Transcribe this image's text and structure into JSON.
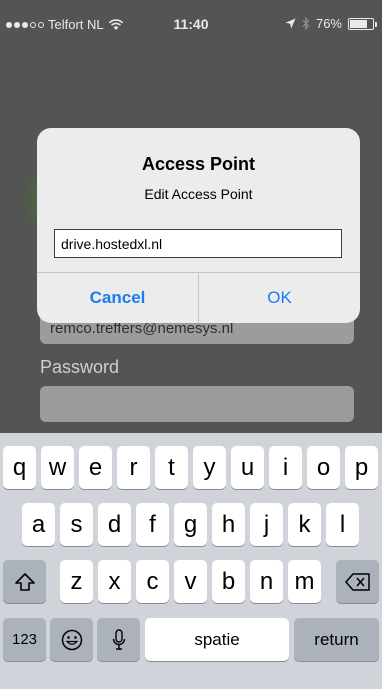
{
  "status_bar": {
    "carrier": "Telfort NL",
    "time": "11:40",
    "battery_percent": "76%",
    "battery_level": 0.76
  },
  "background_form": {
    "email_value": "remco.treffers@nemesys.nl",
    "password_label": "Password"
  },
  "alert": {
    "title": "Access Point",
    "message": "Edit Access Point",
    "input_value": "drive.hostedxl.nl",
    "cancel_label": "Cancel",
    "ok_label": "OK",
    "button_color": "#1a7cf5"
  },
  "keyboard": {
    "row1": [
      "q",
      "w",
      "e",
      "r",
      "t",
      "y",
      "u",
      "i",
      "o",
      "p"
    ],
    "row2": [
      "a",
      "s",
      "d",
      "f",
      "g",
      "h",
      "j",
      "k",
      "l"
    ],
    "row3": [
      "z",
      "x",
      "c",
      "v",
      "b",
      "n",
      "m"
    ],
    "numbers_label": "123",
    "space_label": "spatie",
    "return_label": "return",
    "icons": {
      "shift": "shift-icon",
      "delete": "delete-icon",
      "emoji": "emoji-icon",
      "mic": "microphone-icon"
    }
  }
}
